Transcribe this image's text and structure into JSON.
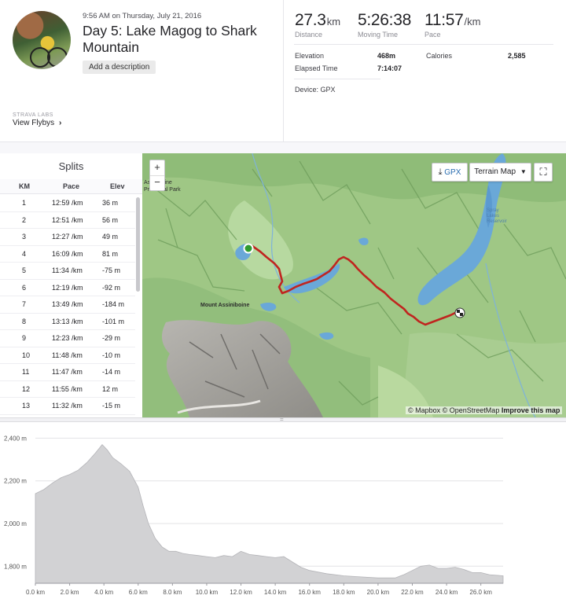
{
  "activity": {
    "datetime": "9:56 AM on Thursday, July 21, 2016",
    "title": "Day 5: Lake Magog to Shark Mountain",
    "add_description_label": "Add a description",
    "labs_label": "STRAVA LABS",
    "flybys_label": "View Flybys"
  },
  "stats": {
    "distance": {
      "value": "27.3",
      "unit": "km",
      "label": "Distance"
    },
    "moving_time": {
      "value": "5:26:38",
      "label": "Moving Time"
    },
    "pace": {
      "value": "11:57",
      "unit": "/km",
      "label": "Pace"
    },
    "elevation_label": "Elevation",
    "elevation_value": "468m",
    "calories_label": "Calories",
    "calories_value": "2,585",
    "elapsed_label": "Elapsed Time",
    "elapsed_value": "7:14:07",
    "device": "Device: GPX"
  },
  "splits": {
    "title": "Splits",
    "headers": {
      "km": "KM",
      "pace": "Pace",
      "elev": "Elev"
    },
    "rows": [
      {
        "km": "1",
        "pace": "12:59 /km",
        "elev": "36 m"
      },
      {
        "km": "2",
        "pace": "12:51 /km",
        "elev": "56 m"
      },
      {
        "km": "3",
        "pace": "12:27 /km",
        "elev": "49 m"
      },
      {
        "km": "4",
        "pace": "16:09 /km",
        "elev": "81 m"
      },
      {
        "km": "5",
        "pace": "11:34 /km",
        "elev": "-75 m"
      },
      {
        "km": "6",
        "pace": "12:19 /km",
        "elev": "-92 m"
      },
      {
        "km": "7",
        "pace": "13:49 /km",
        "elev": "-184 m"
      },
      {
        "km": "8",
        "pace": "13:13 /km",
        "elev": "-101 m"
      },
      {
        "km": "9",
        "pace": "12:23 /km",
        "elev": "-29 m"
      },
      {
        "km": "10",
        "pace": "11:48 /km",
        "elev": "-10 m"
      },
      {
        "km": "11",
        "pace": "11:47 /km",
        "elev": "-14 m"
      },
      {
        "km": "12",
        "pace": "11:55 /km",
        "elev": "12 m"
      },
      {
        "km": "13",
        "pace": "11:32 /km",
        "elev": "-15 m"
      }
    ]
  },
  "map": {
    "zoom_in": "+",
    "zoom_out": "−",
    "gpx_label": "GPX",
    "terrain_label": "Terrain Map",
    "attribution_mapbox": "© Mapbox © OpenStreetMap",
    "attribution_improve": "Improve this map",
    "label_mountain": "Mount Assiniboine",
    "label_park_1": "Assiniboine",
    "label_park_2": "Provincial Park",
    "label_reservoir_1": "Spray",
    "label_reservoir_2": "Lakes",
    "label_reservoir_3": "Reservoir",
    "route_color": "#c0251f",
    "water_color": "#6aa8d8",
    "start_color": "#2f9b2f"
  },
  "chart_data": {
    "type": "area",
    "title": "",
    "xlabel": "",
    "ylabel": "",
    "xlim": [
      0,
      27.3
    ],
    "ylim": [
      1720,
      2420
    ],
    "x_ticks": [
      "0.0 km",
      "2.0 km",
      "4.0 km",
      "6.0 km",
      "8.0 km",
      "10.0 km",
      "12.0 km",
      "14.0 km",
      "16.0 km",
      "18.0 km",
      "20.0 km",
      "22.0 km",
      "24.0 km",
      "26.0 km"
    ],
    "x_tick_values": [
      0,
      2,
      4,
      6,
      8,
      10,
      12,
      14,
      16,
      18,
      20,
      22,
      24,
      26
    ],
    "y_ticks": [
      "1,800 m",
      "2,000 m",
      "2,200 m",
      "2,400 m"
    ],
    "y_tick_values": [
      1800,
      2000,
      2200,
      2400
    ],
    "grid": true,
    "fill_color": "#d2d2d4",
    "series": [
      {
        "x": [
          0,
          0.5,
          1.0,
          1.5,
          2.0,
          2.5,
          3.0,
          3.5,
          3.9,
          4.2,
          4.5,
          5.0,
          5.5,
          6.0,
          6.3,
          6.6,
          7.0,
          7.4,
          7.8,
          8.2,
          8.6,
          9.0,
          9.5,
          10.0,
          10.5,
          11.0,
          11.5,
          12.0,
          12.5,
          13.0,
          13.5,
          14.0,
          14.5,
          15.0,
          15.5,
          16.0,
          17.0,
          18.0,
          19.0,
          20.0,
          21.0,
          21.5,
          22.0,
          22.5,
          23.0,
          23.5,
          24.0,
          24.5,
          25.0,
          25.5,
          26.0,
          26.5,
          27.3
        ],
        "y": [
          2140,
          2160,
          2190,
          2215,
          2230,
          2250,
          2285,
          2330,
          2370,
          2345,
          2310,
          2280,
          2245,
          2170,
          2080,
          2000,
          1930,
          1890,
          1870,
          1870,
          1860,
          1855,
          1850,
          1845,
          1840,
          1850,
          1845,
          1870,
          1855,
          1850,
          1845,
          1840,
          1845,
          1820,
          1795,
          1780,
          1765,
          1755,
          1750,
          1745,
          1745,
          1760,
          1780,
          1800,
          1805,
          1790,
          1790,
          1795,
          1785,
          1770,
          1770,
          1760,
          1755
        ]
      }
    ]
  }
}
